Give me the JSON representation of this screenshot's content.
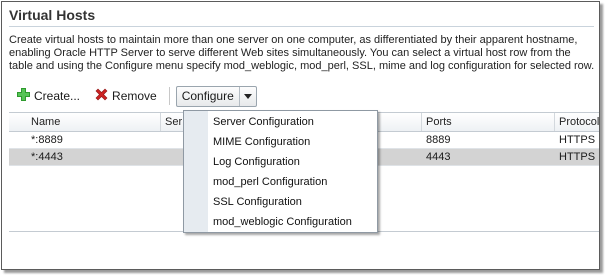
{
  "page": {
    "title": "Virtual Hosts",
    "description": "Create virtual hosts to maintain more than one server on one computer, as differentiated by their apparent hostname, enabling Oracle HTTP Server to serve different Web sites simultaneously. You can select a virtual host row from the table and using the Configure menu specify mod_weblogic, mod_perl, SSL, mime and log configuration for selected row."
  },
  "toolbar": {
    "create_label": "Create...",
    "remove_label": "Remove",
    "configure_label": "Configure",
    "create_icon": "plus-icon",
    "remove_icon": "x-icon"
  },
  "table": {
    "columns": [
      "Name",
      "Ser",
      "Ports",
      "Protocol"
    ],
    "rows": [
      {
        "name": "*:8889",
        "ports": "8889",
        "protocol": "HTTPS",
        "selected": false
      },
      {
        "name": "*:4443",
        "ports": "4443",
        "protocol": "HTTPS",
        "selected": true
      }
    ]
  },
  "configure_menu": {
    "items": [
      "Server Configuration",
      "MIME Configuration",
      "Log Configuration",
      "mod_perl Configuration",
      "SSL Configuration",
      "mod_weblogic Configuration"
    ]
  },
  "colors": {
    "selected_row": "#d3d3d3",
    "plus_icon": "#2e9a2e",
    "remove_icon": "#cc2222"
  }
}
